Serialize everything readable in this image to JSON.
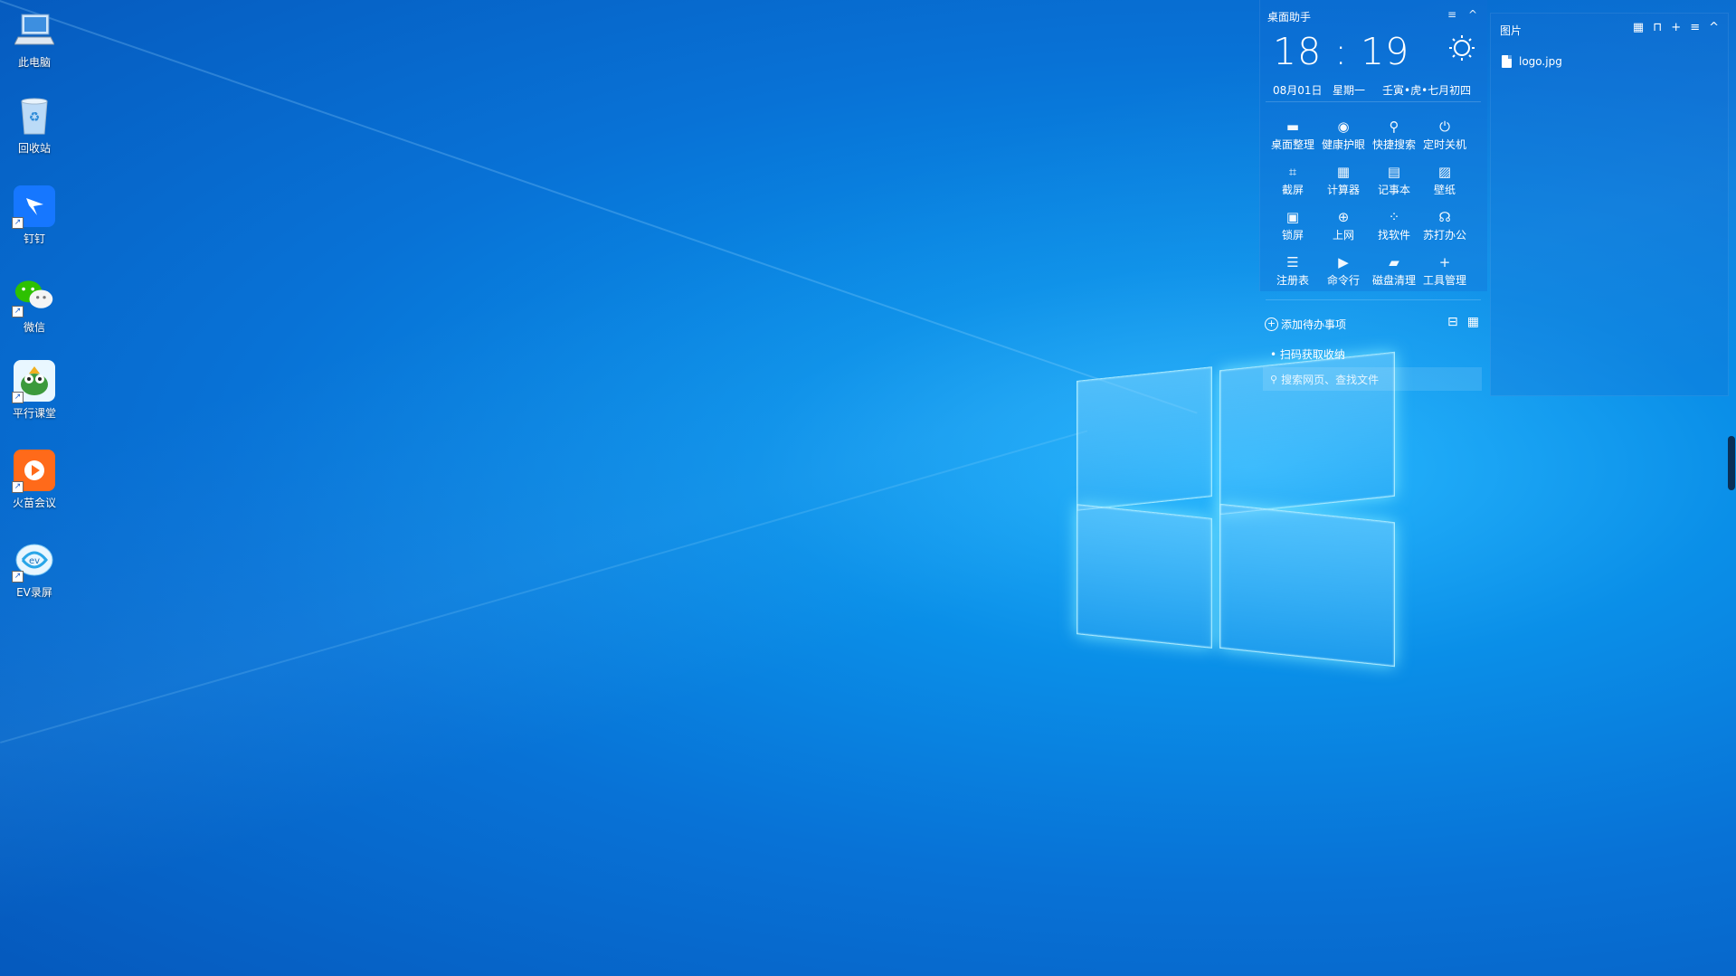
{
  "desktop": {
    "icons": [
      {
        "label": "此电脑",
        "icon": "computer-icon"
      },
      {
        "label": "回收站",
        "icon": "recycle-bin-icon"
      },
      {
        "label": "钉钉",
        "icon": "dingtalk-icon"
      },
      {
        "label": "微信",
        "icon": "wechat-icon"
      },
      {
        "label": "平行课堂",
        "icon": "parallel-classroom-icon"
      },
      {
        "label": "火苗会议",
        "icon": "huomiao-meeting-icon"
      },
      {
        "label": "EV录屏",
        "icon": "ev-recorder-icon"
      }
    ]
  },
  "assistant": {
    "title": "桌面助手",
    "menu_glyph": "≡",
    "collapse_glyph": "^",
    "time": "18 : 19",
    "date": "08月01日",
    "weekday": "星期一",
    "lunar": "壬寅•虎•七月初四",
    "tools": [
      {
        "label": "桌面整理",
        "glyph": "▬",
        "icon": "desktop-organize-icon"
      },
      {
        "label": "健康护眼",
        "glyph": "◉",
        "icon": "eye-care-icon"
      },
      {
        "label": "快捷搜索",
        "glyph": "⚲",
        "icon": "quick-search-icon"
      },
      {
        "label": "定时关机",
        "glyph": "⏻",
        "icon": "timer-shutdown-icon"
      },
      {
        "label": "截屏",
        "glyph": "⌗",
        "icon": "screenshot-icon"
      },
      {
        "label": "计算器",
        "glyph": "▦",
        "icon": "calculator-icon"
      },
      {
        "label": "记事本",
        "glyph": "▤",
        "icon": "notepad-icon"
      },
      {
        "label": "壁纸",
        "glyph": "▨",
        "icon": "wallpaper-icon"
      },
      {
        "label": "锁屏",
        "glyph": "▣",
        "icon": "lock-screen-icon"
      },
      {
        "label": "上网",
        "glyph": "⊕",
        "icon": "browser-icon"
      },
      {
        "label": "找软件",
        "glyph": "⁘",
        "icon": "find-software-icon"
      },
      {
        "label": "苏打办公",
        "glyph": "☊",
        "icon": "soda-office-icon"
      },
      {
        "label": "注册表",
        "glyph": "☰",
        "icon": "registry-icon"
      },
      {
        "label": "命令行",
        "glyph": "▶",
        "icon": "command-line-icon"
      },
      {
        "label": "磁盘清理",
        "glyph": "▰",
        "icon": "disk-cleanup-icon"
      },
      {
        "label": "工具管理",
        "glyph": "+",
        "icon": "tool-manage-icon"
      }
    ],
    "todo_add": "添加待办事项",
    "todo_item": "扫码获取收纳",
    "search_placeholder": "搜索网页、查找文件"
  },
  "pictures": {
    "title": "图片",
    "file": "logo.jpg"
  },
  "colors": {
    "accent": "#0a8fe8",
    "widget_bg": "#146ed2"
  }
}
